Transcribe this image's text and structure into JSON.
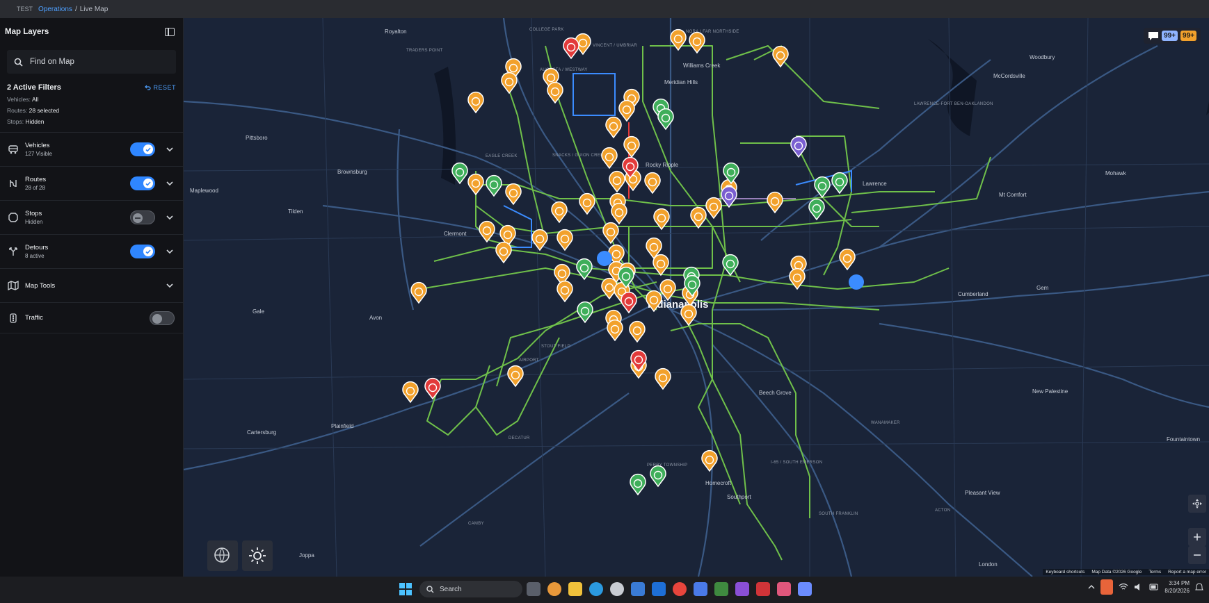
{
  "breadcrumb": {
    "env": "TEST",
    "section": "Operations",
    "separator": "/",
    "page": "Live Map"
  },
  "sidebar": {
    "title": "Map Layers",
    "search_placeholder": "Find on Map",
    "filters": {
      "title": "2 Active Filters",
      "reset_label": "RESET",
      "rows": [
        {
          "key": "Vehicles:",
          "value": "All"
        },
        {
          "key": "Routes:",
          "value": "28 selected"
        },
        {
          "key": "Stops:",
          "value": "Hidden"
        }
      ]
    },
    "layers": [
      {
        "name": "Vehicles",
        "sub": "127 Visible",
        "on": true,
        "icon": "bus-icon"
      },
      {
        "name": "Routes",
        "sub": "28 of 28",
        "on": true,
        "icon": "route-icon"
      },
      {
        "name": "Stops",
        "sub": "Hidden",
        "on": false,
        "icon": "stop-icon"
      },
      {
        "name": "Detours",
        "sub": "8 active",
        "on": true,
        "icon": "detour-icon"
      },
      {
        "name": "Map Tools",
        "sub": "",
        "icon": "map-icon"
      },
      {
        "name": "Traffic",
        "sub": "",
        "on": false,
        "icon": "traffic-icon"
      }
    ]
  },
  "map": {
    "badges": [
      "99+",
      "99+"
    ],
    "places": [
      {
        "label": "Royalton"
      },
      {
        "label": "COLLEGE PARK"
      },
      {
        "label": "NORA / FAR NORTHSIDE"
      },
      {
        "label": "TRADERS POINT"
      },
      {
        "label": "VINCENT / UMBRIAR"
      },
      {
        "label": "Williams Creek"
      },
      {
        "label": "Meridian Hills"
      },
      {
        "label": "AUGUSTA / WESTWAY"
      },
      {
        "label": "Woodbury"
      },
      {
        "label": "McCordsville"
      },
      {
        "label": "LAWRENCE-FORT BEN-OAKLANDON"
      },
      {
        "label": "Pittsboro"
      },
      {
        "label": "EAGLE CREEK"
      },
      {
        "label": "SNACKS / GUION CREEK"
      },
      {
        "label": "Rocky Ripple"
      },
      {
        "label": "Brownsburg"
      },
      {
        "label": "Lawrence"
      },
      {
        "label": "Mohawk"
      },
      {
        "label": "Maplewood"
      },
      {
        "label": "Tilden"
      },
      {
        "label": "Mt Comfort"
      },
      {
        "label": "Clermont"
      },
      {
        "label": "Gem"
      },
      {
        "label": "Gale"
      },
      {
        "label": "Avon"
      },
      {
        "label": "Indianapolis"
      },
      {
        "label": "STOUT FIELD"
      },
      {
        "label": "AIRPORT"
      },
      {
        "label": "Beech Grove"
      },
      {
        "label": "Plainfield"
      },
      {
        "label": "WANAMAKER"
      },
      {
        "label": "New Palestine"
      },
      {
        "label": "Cartersburg"
      },
      {
        "label": "DECATUR"
      },
      {
        "label": "PERRY TOWNSHIP"
      },
      {
        "label": "I-65 / SOUTH EMERSON"
      },
      {
        "label": "Fountaintown"
      },
      {
        "label": "Homecroft"
      },
      {
        "label": "Southport"
      },
      {
        "label": "Pleasant View"
      },
      {
        "label": "ACTON"
      },
      {
        "label": "SOUTH FRANKLIN"
      },
      {
        "label": "CAMBY"
      },
      {
        "label": "Joppa"
      },
      {
        "label": "London"
      },
      {
        "label": "Cumberland"
      }
    ],
    "attribution": [
      "Keyboard shortcuts",
      "Map Data ©2026 Google",
      "Terms",
      "Report a map error"
    ],
    "colors": {
      "route": "#6fc04a",
      "late": "#f2a12c",
      "ontime": "#3fae5a",
      "alert": "#e23a3a",
      "detour": "#7a5fd0",
      "stop": "#3b8cff"
    }
  },
  "taskbar": {
    "search_label": "Search",
    "time": "3:34 PM",
    "date": "8/20/2026"
  }
}
